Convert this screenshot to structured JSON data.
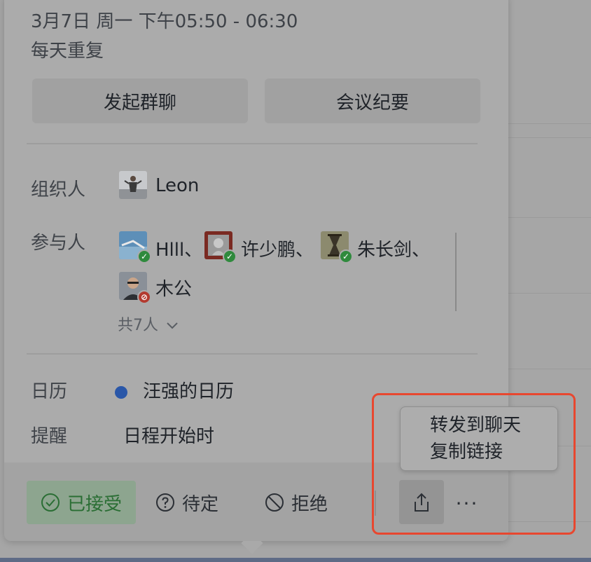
{
  "event": {
    "time": "3月7日 周一 下午05:50 - 06:30",
    "repeat": "每天重复"
  },
  "actions": {
    "group_chat": "发起群聊",
    "minutes": "会议纪要"
  },
  "organizer": {
    "label": "组织人",
    "name": "Leon"
  },
  "participants": {
    "label": "参与人",
    "people": [
      {
        "name": "Hlll、",
        "status": "accepted"
      },
      {
        "name": "许少鹏、",
        "status": "accepted"
      },
      {
        "name": "朱长剑、",
        "status": "accepted"
      },
      {
        "name": "木公",
        "status": "declined"
      }
    ],
    "total": "共7人",
    "expand_icon": "chevron-down-icon"
  },
  "calendar": {
    "label": "日历",
    "name": "汪强的日历",
    "dot_color": "#2a57a8"
  },
  "reminder": {
    "label": "提醒",
    "value": "日程开始时"
  },
  "rsvp": {
    "accepted": "已接受",
    "tentative": "待定",
    "decline": "拒绝"
  },
  "share_menu": {
    "items": [
      "转发到聊天",
      "复制链接"
    ]
  },
  "more_label": "···",
  "colors": {
    "accepted_green": "#2a6e34",
    "highlight_red": "#e8472f"
  }
}
